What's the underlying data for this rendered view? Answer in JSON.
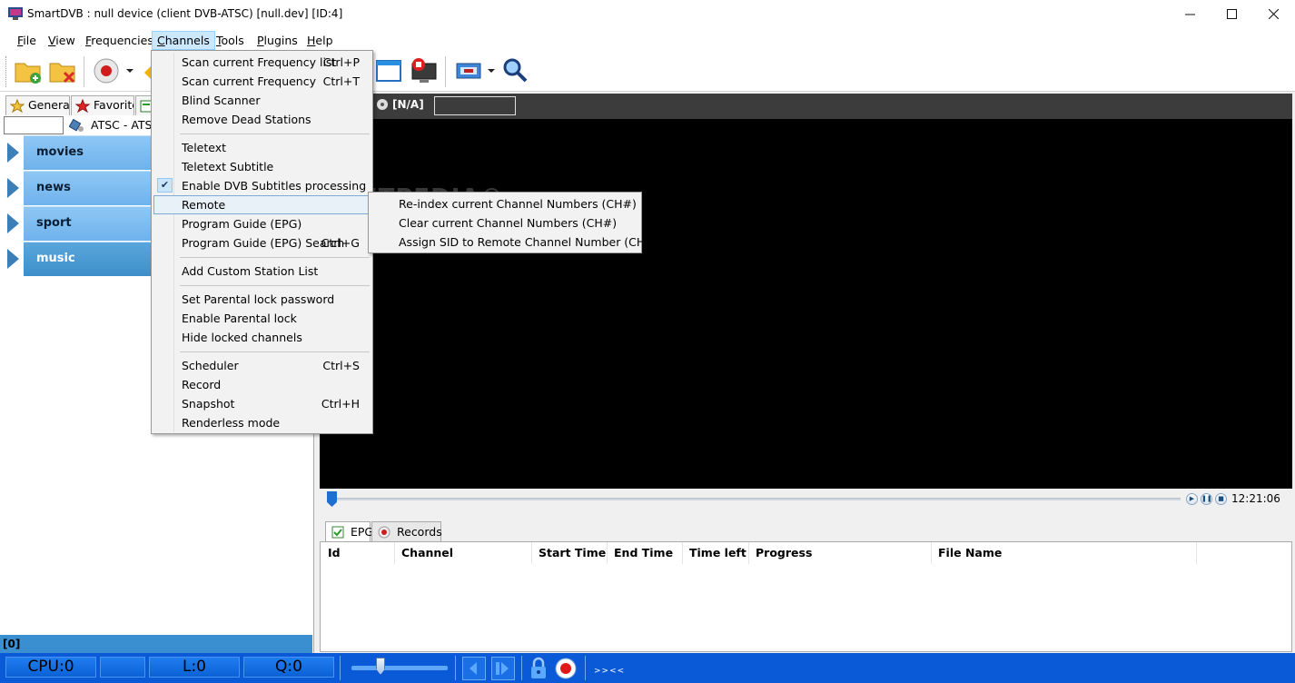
{
  "window": {
    "title": "SmartDVB : null device (client DVB-ATSC) [null.dev]  [ID:4]",
    "minimize": "—",
    "maximize": "☐",
    "close": "✕"
  },
  "menu": {
    "items": [
      {
        "pre": "",
        "u": "F",
        "post": "ile"
      },
      {
        "pre": "",
        "u": "V",
        "post": "iew"
      },
      {
        "pre": "",
        "u": "F",
        "post": "requencies"
      },
      {
        "pre": "",
        "u": "C",
        "post": "hannels"
      },
      {
        "pre": "",
        "u": "T",
        "post": "ools"
      },
      {
        "pre": "",
        "u": "P",
        "post": "lugins"
      },
      {
        "pre": "",
        "u": "H",
        "post": "elp"
      }
    ]
  },
  "left_panel": {
    "tabs": [
      "General",
      "Favorites"
    ],
    "source_label": "ATSC - ATSC",
    "groups": [
      "movies",
      "news",
      "sport",
      "music"
    ],
    "selected_group": "music",
    "status": "[0]"
  },
  "video": {
    "signal_label": "[N/A]",
    "watermark": "SOFTPEDIA®",
    "time": "12:21:06"
  },
  "bottom_panel": {
    "tabs": [
      "EPG",
      "Records"
    ],
    "columns": [
      "Id",
      "Channel",
      "Start Time",
      "End Time",
      "Time left",
      "Progress",
      "File Name"
    ]
  },
  "statusbar": {
    "cpu": "CPU:0",
    "blank": "",
    "l": "L:0",
    "q": "Q:0",
    "marquee": ">><<"
  },
  "channels_menu": {
    "items": [
      {
        "label": "Scan current Frequency list",
        "shortcut": "Ctrl+P"
      },
      {
        "label": "Scan current Frequency",
        "shortcut": "Ctrl+T"
      },
      {
        "label": "Blind Scanner",
        "shortcut": ""
      },
      {
        "label": "Remove Dead Stations",
        "shortcut": ""
      },
      {
        "label": "Teletext",
        "shortcut": ""
      },
      {
        "label": "Teletext Subtitle",
        "shortcut": ""
      },
      {
        "label": "Enable DVB Subtitles processing",
        "shortcut": ""
      },
      {
        "label": "Remote",
        "shortcut": ""
      },
      {
        "label": "Program Guide (EPG)",
        "shortcut": ""
      },
      {
        "label": "Program Guide (EPG) Search",
        "shortcut": "Ctrl+G"
      },
      {
        "label": "Add Custom Station List",
        "shortcut": ""
      },
      {
        "label": "Set Parental lock password",
        "shortcut": ""
      },
      {
        "label": "Enable Parental lock",
        "shortcut": ""
      },
      {
        "label": "Hide locked channels",
        "shortcut": ""
      },
      {
        "label": "Scheduler",
        "shortcut": "Ctrl+S"
      },
      {
        "label": "Record",
        "shortcut": ""
      },
      {
        "label": "Snapshot",
        "shortcut": "Ctrl+H"
      },
      {
        "label": "Renderless mode",
        "shortcut": ""
      }
    ],
    "checked_item": "Enable DVB Subtitles processing",
    "highlighted_item": "Remote",
    "check_glyph": "✔"
  },
  "remote_submenu": {
    "items": [
      "Re-index current Channel Numbers (CH#)",
      "Clear current Channel Numbers (CH#)",
      "Assign SID to Remote Channel Number (CH#)"
    ]
  },
  "colors": {
    "accent": "#0a5ad8",
    "group_bar": "#6fb2ec",
    "group_selected": "#3d8fc9",
    "menu_highlight": "#cce8ff"
  }
}
